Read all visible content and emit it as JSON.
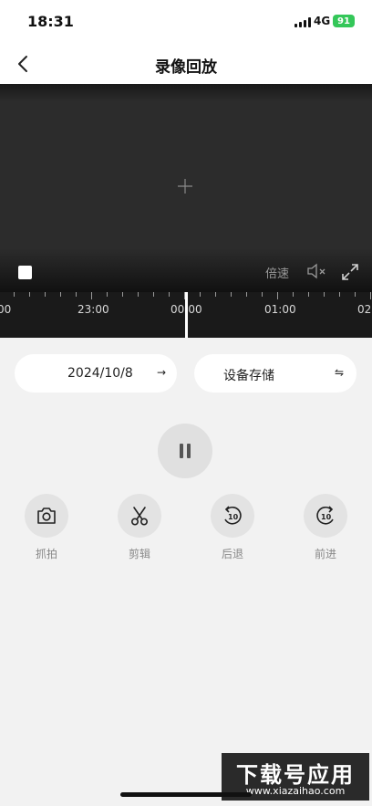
{
  "status": {
    "time": "18:31",
    "network": "4G",
    "battery": "91"
  },
  "nav": {
    "title": "录像回放",
    "back_icon": "chevron-left-icon"
  },
  "player": {
    "speed_label": "倍速",
    "stop_icon": "stop-icon",
    "mute_icon": "mute-icon",
    "fullscreen_icon": "fullscreen-icon"
  },
  "timeline": {
    "labels": [
      "00",
      "23:00",
      "00:00",
      "01:00",
      "02"
    ]
  },
  "controls": {
    "date": "2024/10/8",
    "date_icon": "→",
    "storage": "设备存储",
    "storage_icon": "⇋"
  },
  "actions": [
    {
      "label": "抓拍",
      "icon": "camera-icon"
    },
    {
      "label": "剪辑",
      "icon": "scissors-icon"
    },
    {
      "label": "后退",
      "icon": "rewind-10s-icon"
    },
    {
      "label": "前进",
      "icon": "forward-10s-icon"
    }
  ],
  "watermark": {
    "top": "下载号应用",
    "bottom": "www.xiazaihao.com"
  }
}
